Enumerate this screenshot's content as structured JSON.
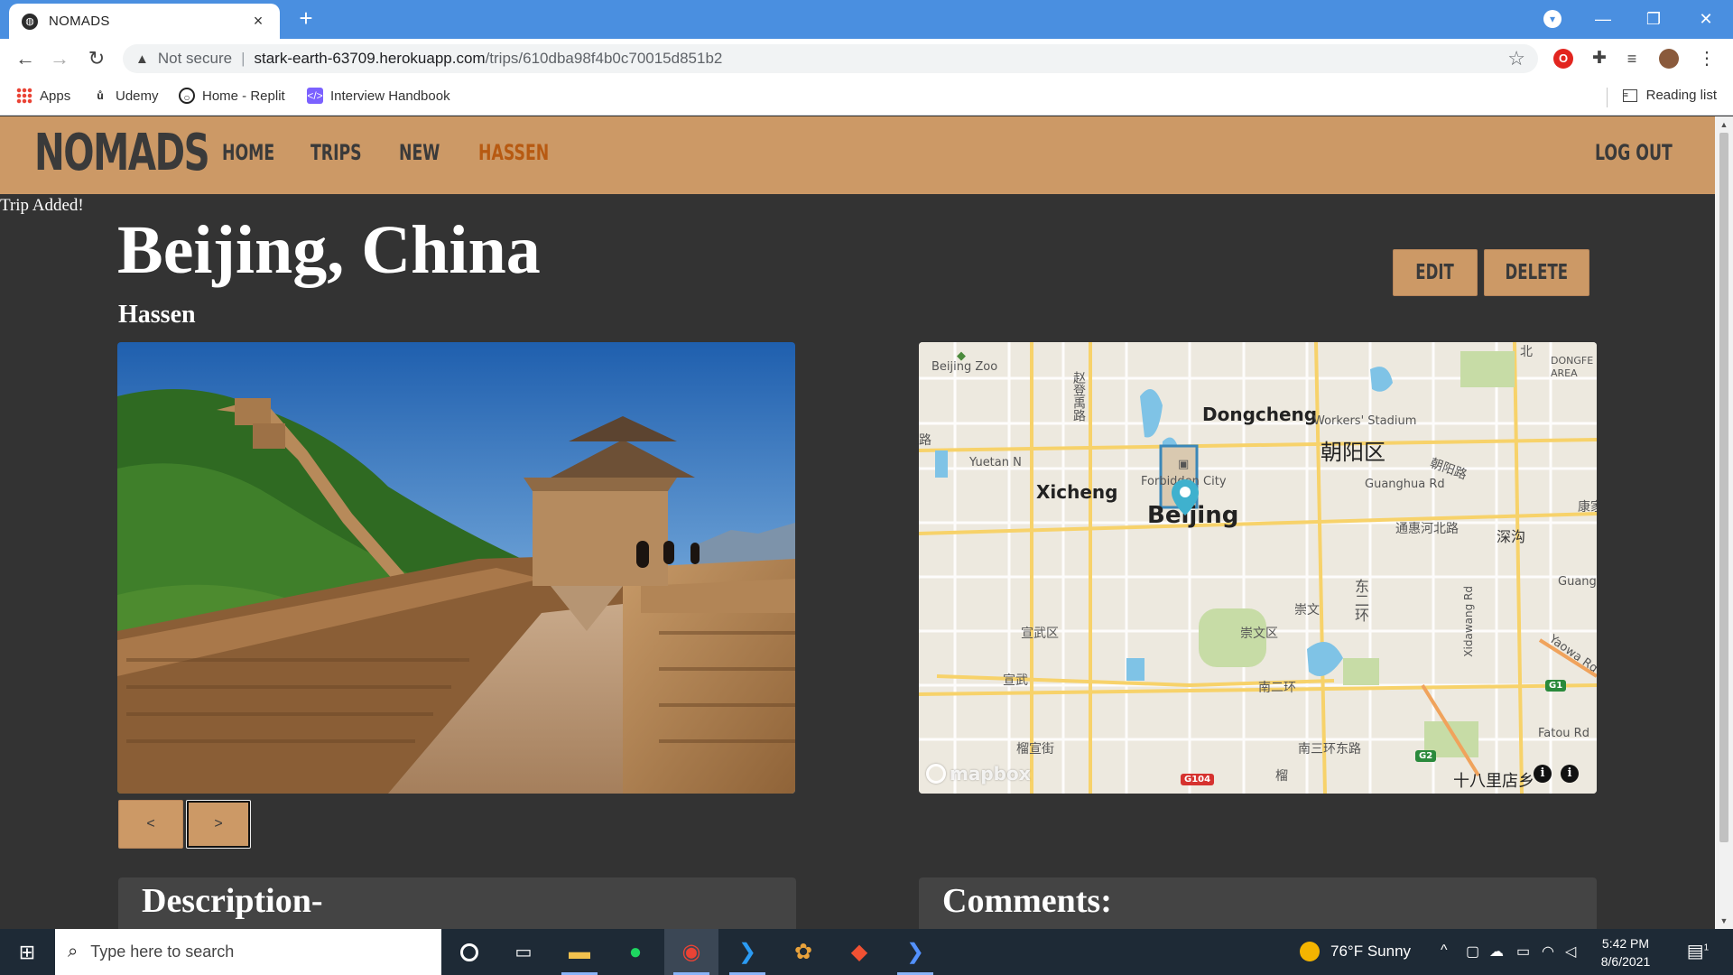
{
  "browser": {
    "tab_title": "NOMADS",
    "tab_close": "×",
    "new_tab": "+",
    "address": {
      "security_label": "Not secure",
      "host": "stark-earth-63709.herokuapp.com",
      "path": "/trips/610dba98f4b0c70015d851b2"
    },
    "bookmarks": [
      {
        "label": "Apps",
        "icon": "apps-grid-icon"
      },
      {
        "label": "Udemy",
        "icon": "udemy-icon"
      },
      {
        "label": "Home - Replit",
        "icon": "replit-icon"
      },
      {
        "label": "Interview Handbook",
        "icon": "code-icon"
      }
    ],
    "reading_list": "Reading list"
  },
  "site": {
    "brand": "NOMADS",
    "nav": {
      "home": "HOME",
      "trips": "TRIPS",
      "new": "NEW",
      "user": "HASSEN",
      "logout": "LOG OUT"
    },
    "accent_color": "#cc9966",
    "active_color": "#b75a12"
  },
  "flash": "Trip Added!",
  "trip": {
    "title": "Beijing, China",
    "user": "Hassen",
    "edit_label": "EDIT",
    "delete_label": "DELETE",
    "prev_label": "<",
    "next_label": ">",
    "description_heading": "Description-",
    "comments_heading": "Comments:"
  },
  "map": {
    "labels": {
      "beijing_zoo": "Beijing Zoo",
      "dongcheng": "Dongcheng",
      "workers_stadium": "Workers' Stadium",
      "chaoyang_cn": "朝阳区",
      "yuetan": "Yuetan N",
      "xicheng": "Xicheng",
      "forbidden_city": "Forbidden City",
      "beijing": "Beijing",
      "guanghua": "Guanghua Rd",
      "chaoyang_rd": "朝阳路",
      "tonghui": "通惠河北路",
      "shengou": "深沟",
      "kang": "康家",
      "dongerhuan": "东二环",
      "chongwen": "崇文",
      "chongwenqu": "崇文区",
      "xuanwuqu": "宣武区",
      "xuanwu": "宣武",
      "xidawang": "Xidawang Rd",
      "guang": "Guange",
      "yaowa": "Yaowa Rd",
      "nanerhuan": "南二环",
      "fatou": "Fatou Rd",
      "youanjie": "榴宣街",
      "nansanhuan": "南三环东路",
      "shibali": "十八里店乡",
      "dongfeng": "DONGFE AREA",
      "zhao": "赵登禹路",
      "bei": "北",
      "lu": "路",
      "liu": "榴"
    },
    "shields": {
      "g104": "G104",
      "g2": "G2",
      "g1": "G1"
    },
    "attribution": "mapbox",
    "info": "i"
  },
  "taskbar": {
    "search_placeholder": "Type here to search",
    "weather": "76°F  Sunny",
    "time": "5:42 PM",
    "date": "8/6/2021",
    "notifications": "1"
  }
}
